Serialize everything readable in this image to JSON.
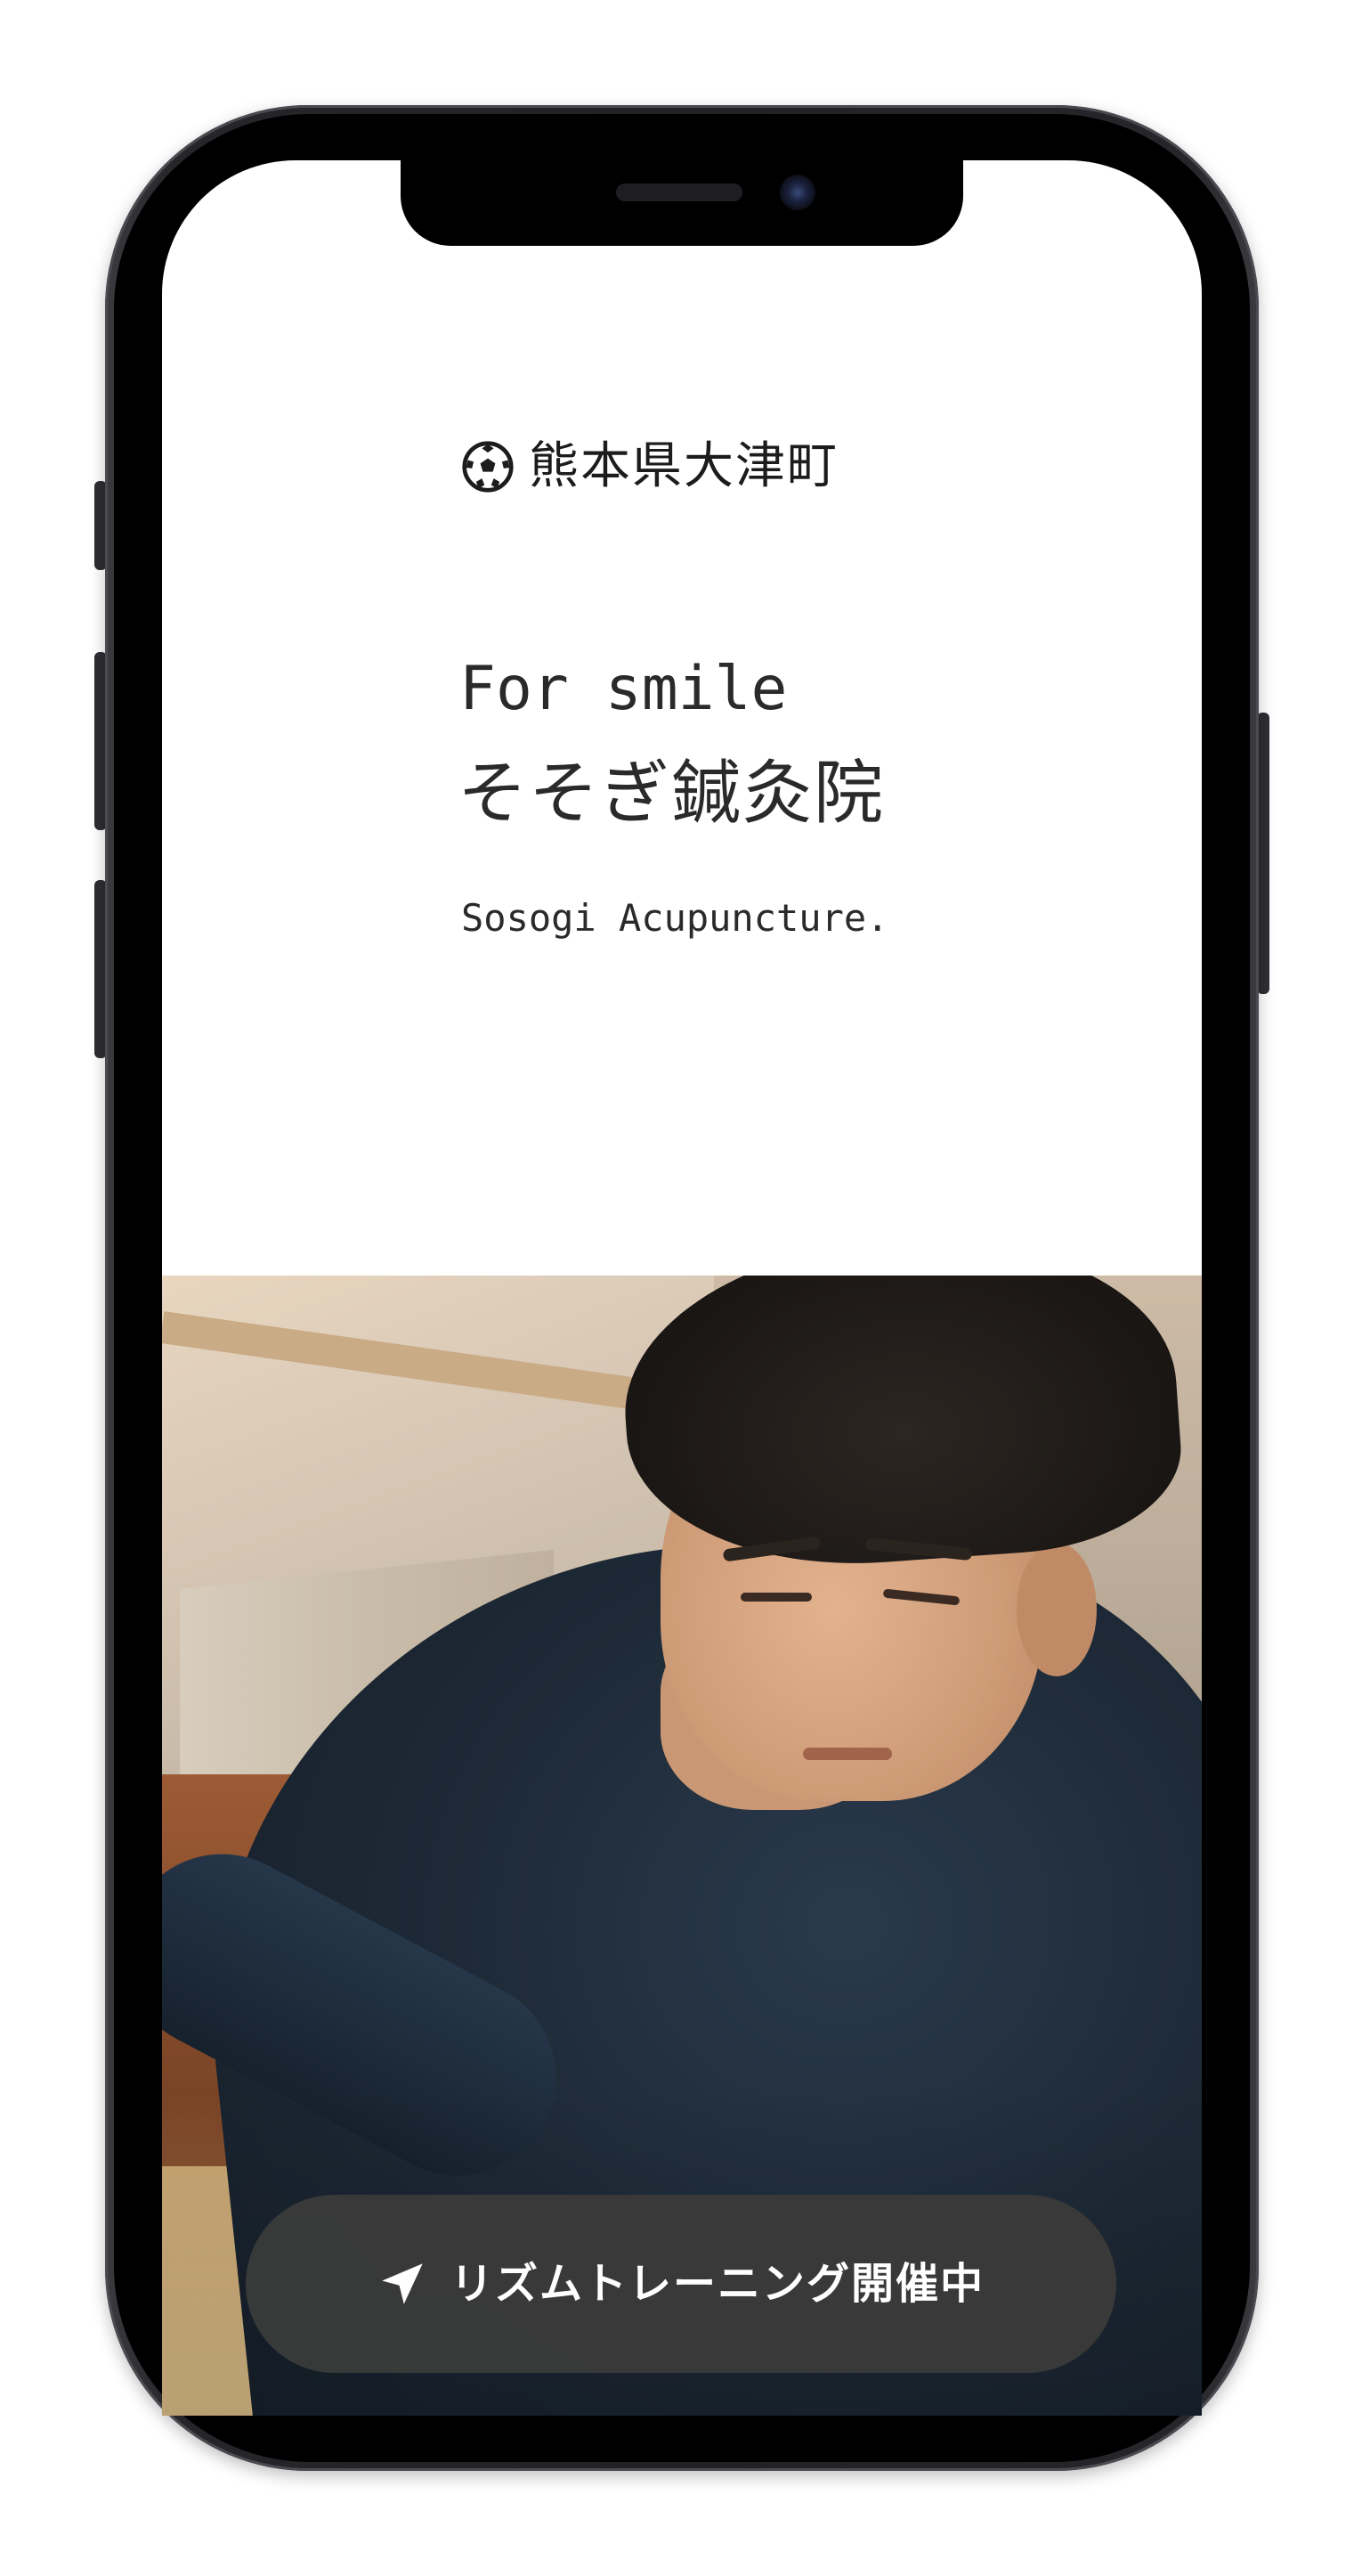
{
  "header": {
    "location_icon": "soccer-ball-icon",
    "location": "熊本県大津町"
  },
  "hero_text": {
    "tagline": "For smile",
    "clinic_name": "そそぎ鍼灸院",
    "clinic_name_roman": "Sosogi Acupuncture."
  },
  "hero_image": {
    "alt": "photo"
  },
  "cta": {
    "icon": "navigation-arrow-icon",
    "label": "リズムトレーニング開催中"
  },
  "colors": {
    "text": "#2a2a2a",
    "background": "#ffffff",
    "cta_background": "#3a3a3a",
    "cta_text": "#ffffff"
  }
}
